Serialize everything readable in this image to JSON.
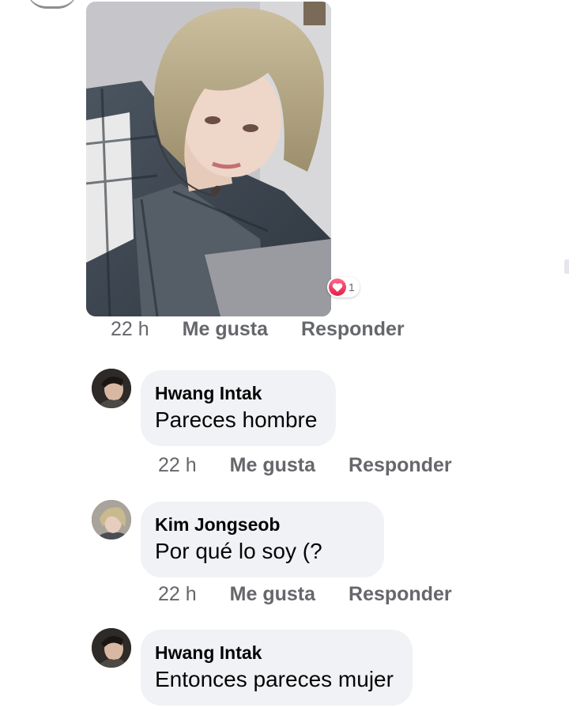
{
  "post": {
    "photo_alt": "selfie photo",
    "reaction_count": "1",
    "meta": {
      "time": "22 h",
      "like_label": "Me gusta",
      "reply_label": "Responder"
    }
  },
  "comments": [
    {
      "author": "Hwang Intak",
      "text": "Pareces hombre",
      "time": "22 h",
      "like_label": "Me gusta",
      "reply_label": "Responder"
    },
    {
      "author": "Kim Jongseob",
      "text": "Por qué lo soy (?",
      "time": "22 h",
      "like_label": "Me gusta",
      "reply_label": "Responder"
    },
    {
      "author": "Hwang Intak",
      "text": "Entonces pareces mujer"
    }
  ],
  "colors": {
    "meta_text": "#65676b",
    "bubble_bg": "#f0f2f5",
    "heart": "#e41e4a"
  },
  "icons": {
    "reaction": "heart-icon"
  }
}
